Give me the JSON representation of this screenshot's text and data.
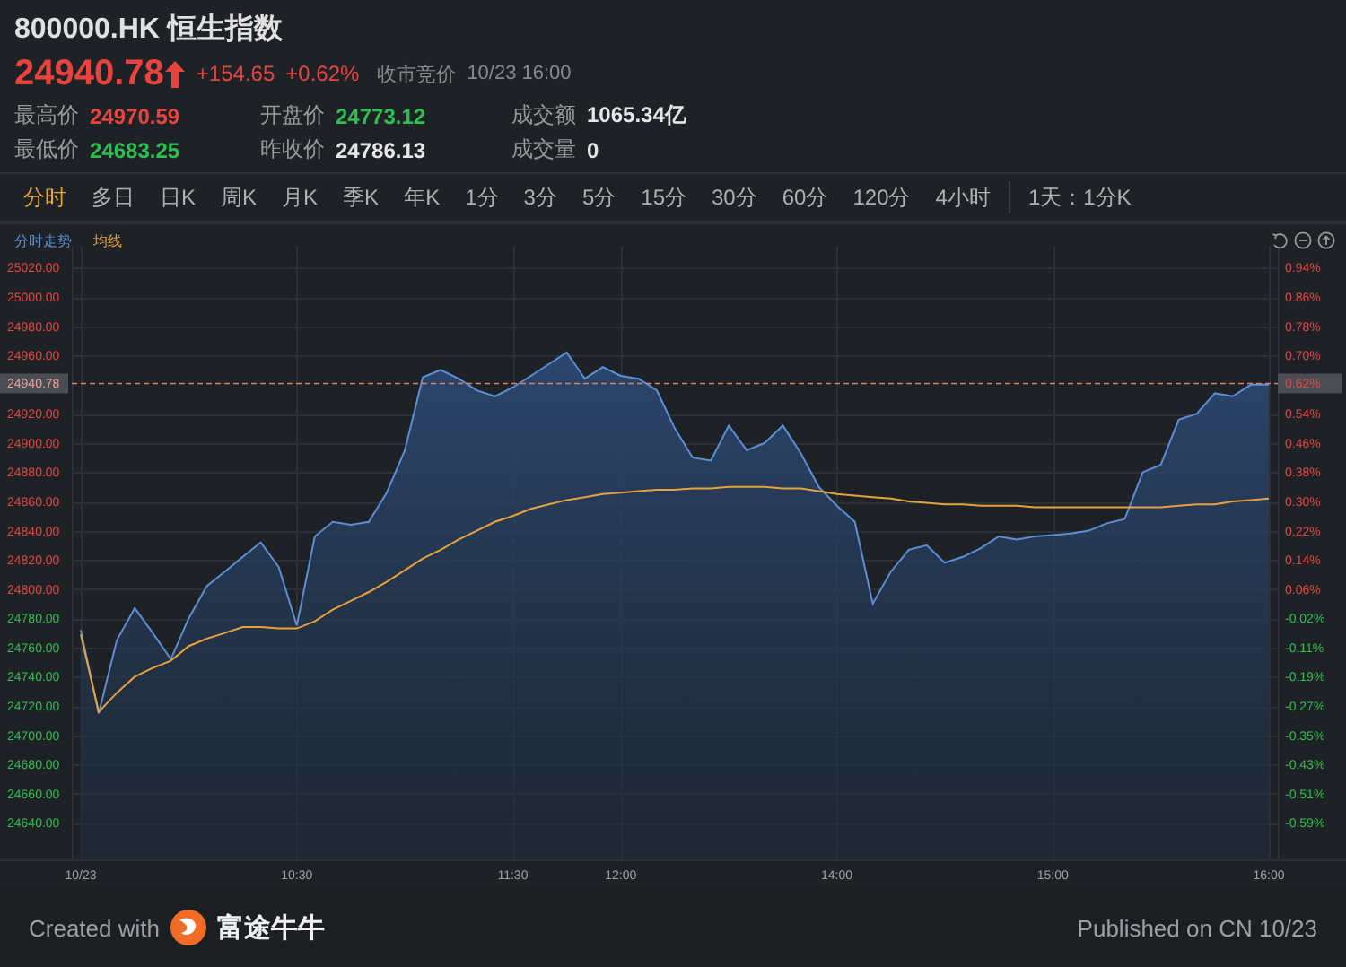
{
  "quote": {
    "title": "800000.HK 恒生指数",
    "price": "24940.78",
    "change": "+154.65",
    "change_pct": "+0.62%",
    "session": "收市竞价",
    "time": "10/23 16:00"
  },
  "stats": [
    {
      "label": "最高价",
      "value": "24970.59",
      "color": "#e8443f"
    },
    {
      "label": "开盘价",
      "value": "24773.12",
      "color": "#2fbf4f"
    },
    {
      "label": "成交额",
      "value": "1065.34亿",
      "color": "#e6e6e6"
    },
    {
      "label": "最低价",
      "value": "24683.25",
      "color": "#2fbf4f"
    },
    {
      "label": "昨收价",
      "value": "24786.13",
      "color": "#e6e6e6"
    },
    {
      "label": "成交量",
      "value": "0",
      "color": "#e6e6e6"
    }
  ],
  "tabs": [
    {
      "label": "分时",
      "kind": "period",
      "selected": true
    },
    {
      "label": "多日",
      "kind": "period",
      "selected": false
    },
    {
      "label": "日K",
      "kind": "period",
      "selected": false
    },
    {
      "label": "周K",
      "kind": "period",
      "selected": false
    },
    {
      "label": "月K",
      "kind": "period",
      "selected": false
    },
    {
      "label": "季K",
      "kind": "period",
      "selected": false
    },
    {
      "label": "年K",
      "kind": "period",
      "selected": false
    },
    {
      "label": "1分",
      "kind": "period",
      "selected": false
    },
    {
      "label": "3分",
      "kind": "period",
      "selected": false
    },
    {
      "label": "5分",
      "kind": "period",
      "selected": false
    },
    {
      "label": "15分",
      "kind": "period",
      "selected": false
    },
    {
      "label": "30分",
      "kind": "period",
      "selected": false
    },
    {
      "label": "60分",
      "kind": "period",
      "selected": false
    },
    {
      "label": "120分",
      "kind": "period",
      "selected": false
    },
    {
      "label": "4小时",
      "kind": "period",
      "selected": false
    },
    {
      "label": "1天：1分K",
      "kind": "mode",
      "selected": false
    }
  ],
  "chart": {
    "chart_data": {
      "type": "area",
      "grid": true,
      "categories": [
        "10/23",
        null,
        null,
        null,
        null,
        null,
        null,
        null,
        null,
        null,
        null,
        null,
        "10:30",
        null,
        null,
        null,
        null,
        null,
        null,
        null,
        null,
        null,
        null,
        null,
        "11:30",
        null,
        null,
        null,
        null,
        null,
        "12:00",
        null,
        null,
        null,
        null,
        null,
        null,
        null,
        null,
        null,
        null,
        null,
        "14:00",
        null,
        null,
        null,
        null,
        null,
        null,
        null,
        null,
        null,
        null,
        null,
        "15:00",
        null,
        null,
        null,
        null,
        null,
        null,
        null,
        null,
        null,
        null,
        null,
        "16:00"
      ],
      "series": [
        {
          "name": "分时走势",
          "type": "area",
          "color": "#5b8fd6",
          "values": [
            24772,
            24715,
            24765,
            24787,
            24770,
            24752,
            24780,
            24802,
            24812,
            24822,
            24832,
            24815,
            24775,
            24836,
            24846,
            24844,
            24846,
            24866,
            24895,
            24945,
            24950,
            24944,
            24936,
            24932,
            24938,
            24946,
            24954,
            24962,
            24944,
            24952,
            24946,
            24944,
            24936,
            24910,
            24890,
            24888,
            24912,
            24895,
            24900,
            24912,
            24893,
            24870,
            24857,
            24846,
            24790,
            24812,
            24827,
            24830,
            24818,
            24822,
            24828,
            24836,
            24834,
            24836,
            24837,
            24838,
            24840,
            24845,
            24848,
            24880,
            24885,
            24916,
            24920,
            24934,
            24932,
            24940,
            24940
          ]
        },
        {
          "name": "均线",
          "type": "line",
          "color": "#e6a23c",
          "values": [
            24769,
            24716,
            24729,
            24740,
            24746,
            24751,
            24761,
            24766,
            24770,
            24774,
            24774,
            24773,
            24773,
            24778,
            24786,
            24792,
            24798,
            24805,
            24813,
            24821,
            24827,
            24834,
            24840,
            24846,
            24850,
            24855,
            24858,
            24861,
            24863,
            24865,
            24866,
            24867,
            24868,
            24868,
            24869,
            24869,
            24870,
            24870,
            24870,
            24869,
            24869,
            24867,
            24865,
            24864,
            24863,
            24862,
            24860,
            24859,
            24858,
            24858,
            24857,
            24857,
            24857,
            24856,
            24856,
            24856,
            24856,
            24856,
            24856,
            24856,
            24856,
            24857,
            24858,
            24858,
            24860,
            24861,
            24862
          ]
        }
      ],
      "ylim": [
        24615,
        25035
      ],
      "yticks": [
        {
          "value": 25020,
          "label": "25020.00"
        },
        {
          "value": 25000,
          "label": "25000.00"
        },
        {
          "value": 24980,
          "label": "24980.00"
        },
        {
          "value": 24960,
          "label": "24960.00"
        },
        {
          "value": 24920,
          "label": "24920.00"
        },
        {
          "value": 24900,
          "label": "24900.00"
        },
        {
          "value": 24880,
          "label": "24880.00"
        },
        {
          "value": 24860,
          "label": "24860.00"
        },
        {
          "value": 24840,
          "label": "24840.00"
        },
        {
          "value": 24820,
          "label": "24820.00"
        },
        {
          "value": 24800,
          "label": "24800.00"
        },
        {
          "value": 24780,
          "label": "24780.00"
        },
        {
          "value": 24760,
          "label": "24760.00"
        },
        {
          "value": 24740,
          "label": "24740.00"
        },
        {
          "value": 24720,
          "label": "24720.00"
        },
        {
          "value": 24700,
          "label": "24700.00"
        },
        {
          "value": 24680,
          "label": "24680.00"
        },
        {
          "value": 24660,
          "label": "24660.00"
        },
        {
          "value": 24640,
          "label": "24640.00"
        }
      ],
      "ref_lines": [
        {
          "axis": "y",
          "value": 24940.78,
          "label": "24940.78"
        }
      ]
    },
    "right_ticks": [
      {
        "label": "0.94%",
        "color": "#e8443f"
      },
      {
        "label": "0.86%",
        "color": "#e8443f"
      },
      {
        "label": "0.78%",
        "color": "#e8443f"
      },
      {
        "label": "0.70%",
        "color": "#e8443f"
      },
      {
        "label": "0.54%",
        "color": "#e8443f"
      },
      {
        "label": "0.46%",
        "color": "#e8443f"
      },
      {
        "label": "0.38%",
        "color": "#e8443f"
      },
      {
        "label": "0.30%",
        "color": "#e8443f"
      },
      {
        "label": "0.22%",
        "color": "#e8443f"
      },
      {
        "label": "0.14%",
        "color": "#e8443f"
      },
      {
        "label": "0.06%",
        "color": "#e8443f"
      },
      {
        "label": "-0.02%",
        "color": "#2fbf4f"
      },
      {
        "label": "-0.11%",
        "color": "#2fbf4f"
      },
      {
        "label": "-0.19%",
        "color": "#2fbf4f"
      },
      {
        "label": "-0.27%",
        "color": "#2fbf4f"
      },
      {
        "label": "-0.35%",
        "color": "#2fbf4f"
      },
      {
        "label": "-0.43%",
        "color": "#2fbf4f"
      },
      {
        "label": "-0.51%",
        "color": "#2fbf4f"
      },
      {
        "label": "-0.59%",
        "color": "#2fbf4f"
      }
    ],
    "right_tag": {
      "label": "0.62%",
      "color": "#e8443f"
    }
  },
  "footer": {
    "created": "Created with",
    "brand": "富途牛牛",
    "published": "Published on CN 10/23"
  }
}
